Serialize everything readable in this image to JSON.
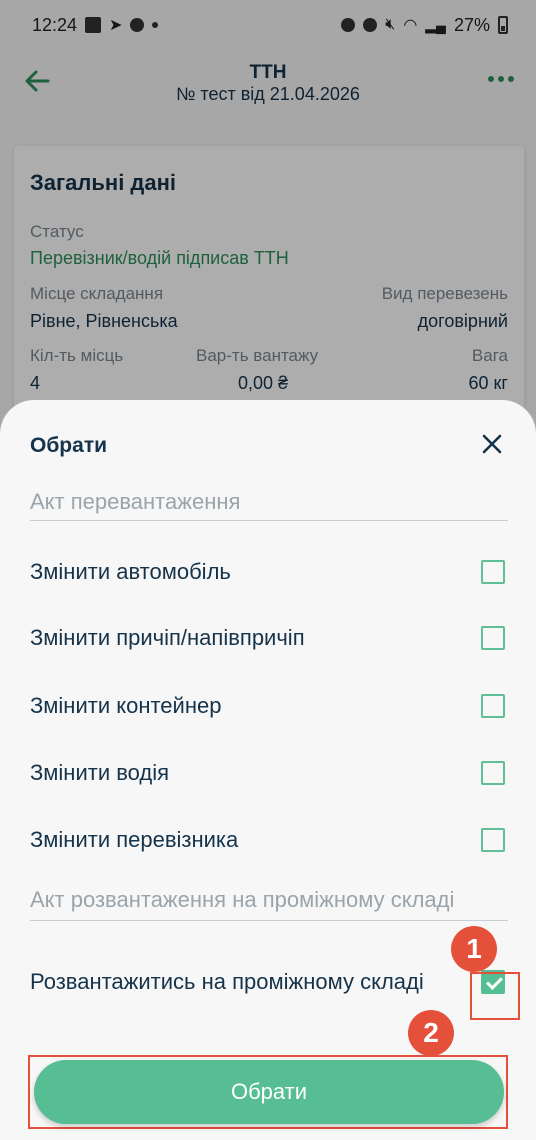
{
  "status_bar": {
    "time": "12:24",
    "battery": "27%"
  },
  "header": {
    "title": "ТТН",
    "subtitle": "№ тест від 21.04.2026"
  },
  "card": {
    "title": "Загальні дані",
    "status_label": "Статус",
    "status_value": "Перевізник/водій підписав ТТН",
    "place_label": "Місце складання",
    "place_value": "Рівне, Рівненська",
    "transport_label": "Вид перевезень",
    "transport_value": "договірний",
    "count_label": "Кіл-ть місць",
    "count_value": "4",
    "cost_label": "Вар-ть вантажу",
    "cost_value": "0,00 ₴",
    "weight_label": "Вага",
    "weight_value": "60 кг"
  },
  "sheet": {
    "title": "Обрати",
    "section1": "Акт перевантаження",
    "options": [
      {
        "label": "Змінити автомобіль",
        "checked": false
      },
      {
        "label": "Змінити причіп/напівпричіп",
        "checked": false
      },
      {
        "label": "Змінити контейнер",
        "checked": false
      },
      {
        "label": "Змінити водія",
        "checked": false
      },
      {
        "label": "Змінити перевізника",
        "checked": false
      }
    ],
    "section2": "Акт розвантаження на проміжному складі",
    "option_unload": {
      "label": "Розвантажитись на проміжному складі",
      "checked": true
    },
    "button": "Обрати"
  },
  "annotations": {
    "badge1": "1",
    "badge2": "2",
    "color": "#e4503a"
  },
  "colors": {
    "accent": "#56be92",
    "text": "#15334a",
    "muted": "#9aa4ab"
  }
}
